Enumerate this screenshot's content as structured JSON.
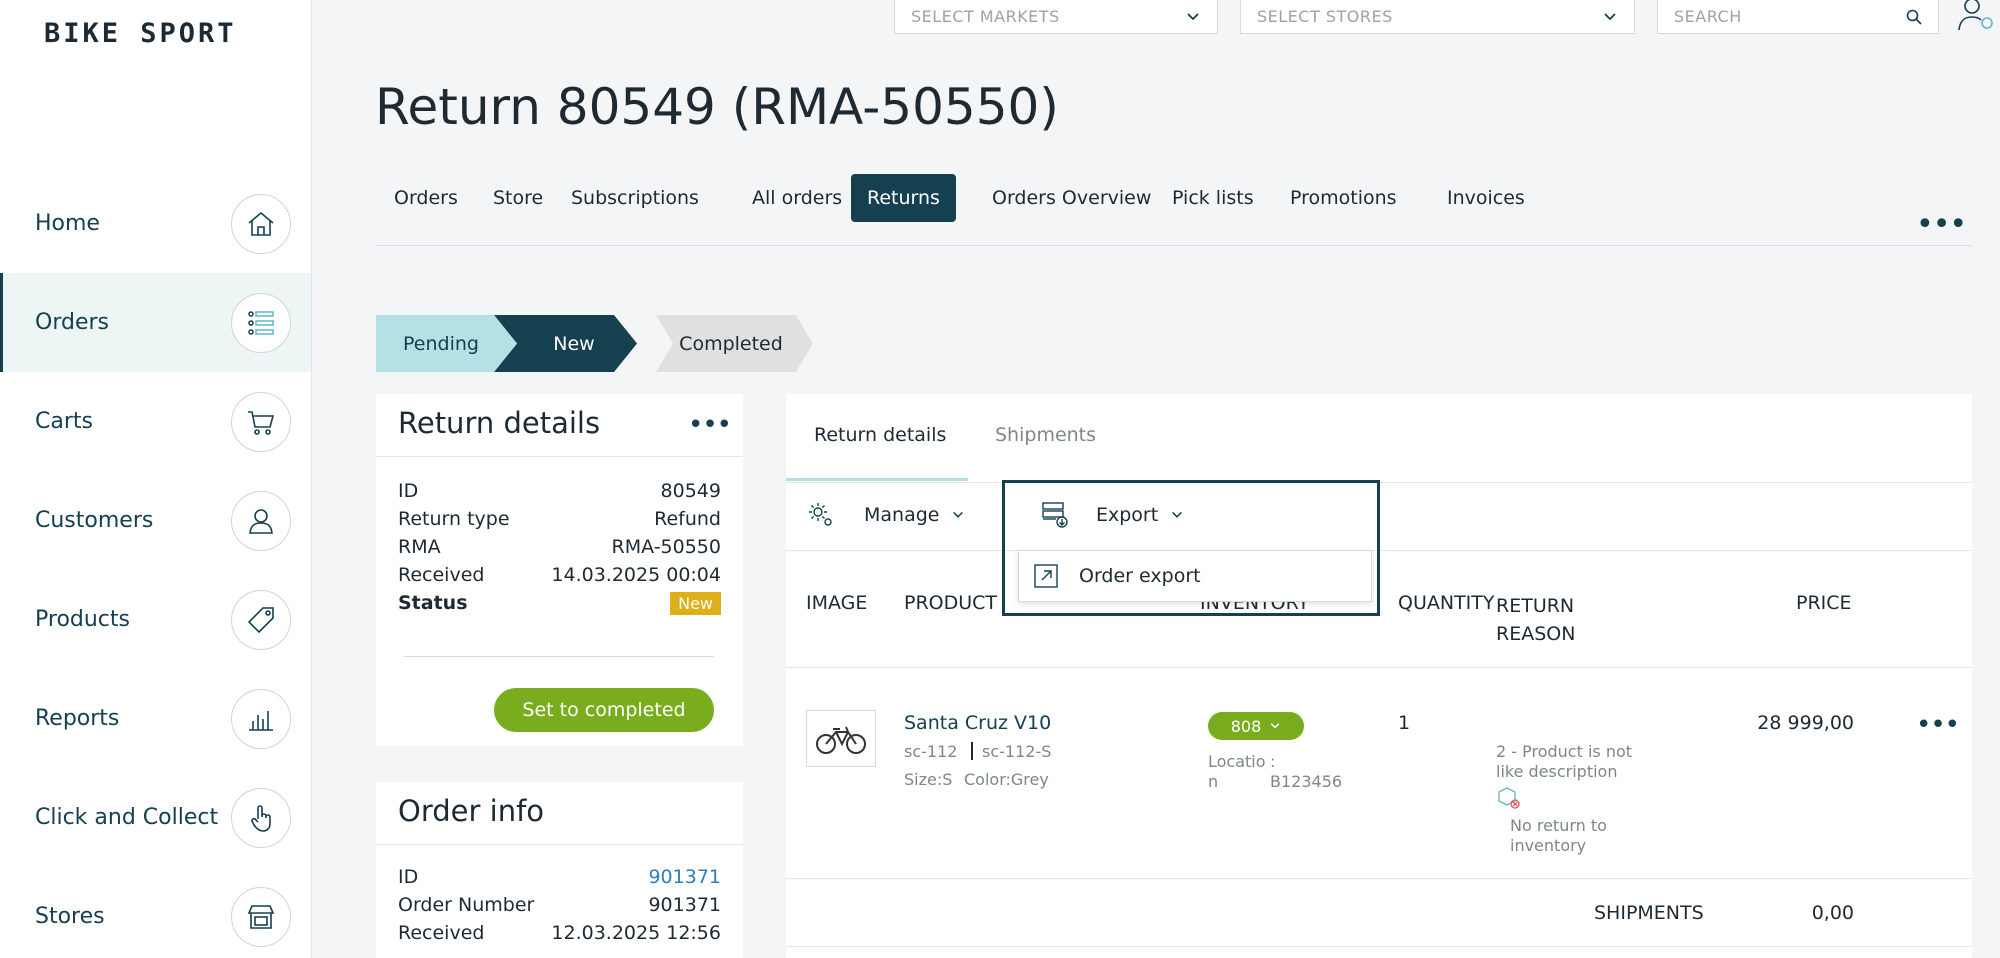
{
  "app": {
    "logo": "BIKE SPORT"
  },
  "topbar": {
    "markets_placeholder": "SELECT MARKETS",
    "stores_placeholder": "SELECT STORES",
    "search_placeholder": "SEARCH"
  },
  "sidebar": {
    "items": [
      {
        "label": "Home",
        "icon": "home-icon"
      },
      {
        "label": "Orders",
        "icon": "list-icon"
      },
      {
        "label": "Carts",
        "icon": "cart-icon"
      },
      {
        "label": "Customers",
        "icon": "person-icon"
      },
      {
        "label": "Products",
        "icon": "tag-icon"
      },
      {
        "label": "Reports",
        "icon": "bar-chart-icon"
      },
      {
        "label": "Click and Collect",
        "icon": "hand-pointer-icon"
      },
      {
        "label": "Stores",
        "icon": "store-icon"
      }
    ]
  },
  "page": {
    "title": "Return 80549 (RMA-50550)"
  },
  "tabs": [
    {
      "label": "Orders"
    },
    {
      "label": "Store"
    },
    {
      "label": "Subscriptions"
    },
    {
      "label": "All orders"
    },
    {
      "label": "Returns"
    },
    {
      "label": "Orders Overview"
    },
    {
      "label": "Pick lists"
    },
    {
      "label": "Promotions"
    },
    {
      "label": "Invoices"
    }
  ],
  "stepper": [
    "Pending",
    "New",
    "Completed"
  ],
  "return_details": {
    "title": "Return details",
    "rows": [
      {
        "k": "ID",
        "v": "80549"
      },
      {
        "k": "Return type",
        "v": "Refund"
      },
      {
        "k": "RMA",
        "v": "RMA-50550"
      },
      {
        "k": "Received",
        "v": "14.03.2025 00:04"
      }
    ],
    "status_label": "Status",
    "status_value": "New",
    "action": "Set to completed"
  },
  "order_info": {
    "title": "Order info",
    "rows": [
      {
        "k": "ID",
        "v": "901371"
      },
      {
        "k": "Order Number",
        "v": "901371"
      },
      {
        "k": "Received",
        "v": "12.03.2025 12:56"
      }
    ]
  },
  "panel": {
    "tabs": [
      "Return details",
      "Shipments"
    ],
    "manage": "Manage",
    "export": "Export",
    "export_menu": [
      "Order export"
    ],
    "columns": {
      "image": "IMAGE",
      "product": "PRODUCT",
      "inventory": "INVENTORY",
      "quantity": "QUANTITY",
      "return_reason": "RETURN REASON",
      "price": "PRICE"
    },
    "row": {
      "name": "Santa Cruz V10",
      "sku": "sc-112",
      "variant_sku": "sc-112-S",
      "size": "Size:S",
      "color": "Color:Grey",
      "inventory": "808",
      "location_label": "Locatio n",
      "location_sep": ":",
      "location_value": "B123456",
      "quantity": "1",
      "reason": "2 - Product is not like description",
      "no_return": "No return to inventory",
      "price": "28 999,00"
    },
    "shipments_label": "SHIPMENTS",
    "shipments_value": "0,00"
  },
  "colors": {
    "primary": "#15404f",
    "accent": "#79ad1d",
    "badge": "#ddb01a",
    "step_pending": "#b3e1e5",
    "step_completed": "#e0e0e0"
  }
}
